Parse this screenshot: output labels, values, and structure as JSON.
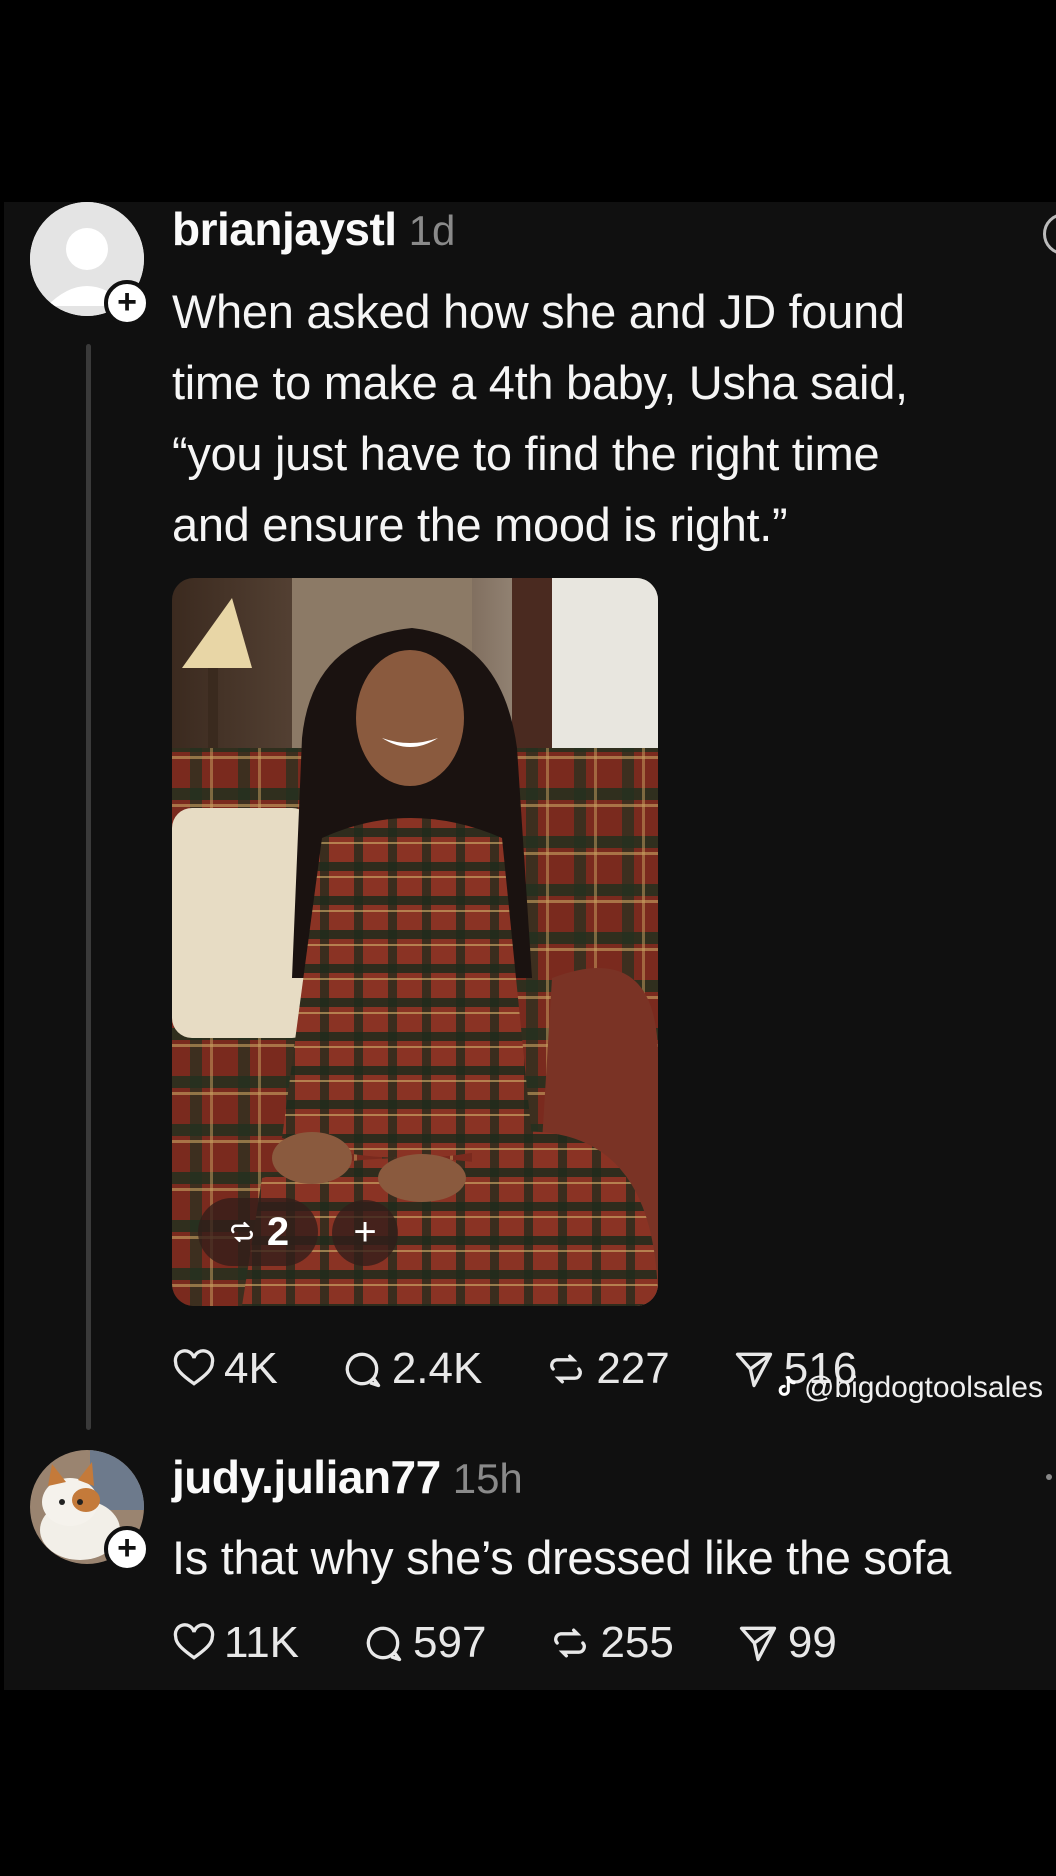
{
  "posts": [
    {
      "username": "brianjaystl",
      "time": "1d",
      "text_lines": [
        "When asked how she and JD found",
        "time to make a 4th baby, Usha said,",
        "“you just have to find the right time",
        "and ensure the mood is right.”"
      ],
      "media": {
        "repost_count": "2",
        "add_symbol": "+"
      },
      "stats": {
        "likes": "4K",
        "replies": "2.4K",
        "reposts": "227",
        "shares": "516"
      }
    },
    {
      "username": "judy.julian77",
      "time": "15h",
      "text": "Is that why she’s dressed like the sofa",
      "stats": {
        "likes": "11K",
        "replies": "597",
        "reposts": "255",
        "shares": "99"
      }
    }
  ],
  "watermark": {
    "handle": "@bigdogtoolsales",
    "icon": "tiktok-icon"
  },
  "badge_symbol": "+",
  "colors": {
    "background": "#000000",
    "panel": "#101010",
    "muted": "#8a8a8a",
    "text": "#f5f5f5"
  }
}
